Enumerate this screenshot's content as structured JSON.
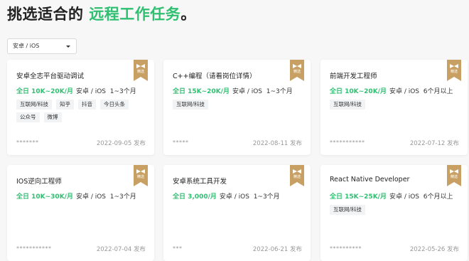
{
  "heading": {
    "prefix": "挑选适合的",
    "highlight": "远程工作任务",
    "suffix": "。"
  },
  "filter": {
    "selected": "安卓 / iOS"
  },
  "ribbon_label": "精选",
  "publish_suffix": "发布",
  "jobs": [
    {
      "title": "安卓全志平台驱动调试",
      "salary": "全日 10K~20K/月",
      "platform": "安卓 / iOS",
      "duration": "1~3个月",
      "tags": [
        "互联网/科技",
        "知乎",
        "抖音",
        "今日头条",
        "公众号",
        "微博"
      ],
      "masked": "*******",
      "date": "2022-09-05"
    },
    {
      "title": "C++编程（请看岗位详情）",
      "salary": "全日 15K~20K/月",
      "platform": "安卓 / iOS",
      "duration": "1~3个月",
      "tags": [
        "互联网/科技"
      ],
      "masked": "*****",
      "date": "2022-08-11"
    },
    {
      "title": "前端开发工程师",
      "salary": "全日 10K~20K/月",
      "platform": "安卓 / iOS",
      "duration": "6个月以上",
      "tags": [
        "互联网/科技"
      ],
      "masked": "***********",
      "date": "2022-07-12"
    },
    {
      "title": "IOS逆向工程师",
      "salary": "全日 10K~30K/月",
      "platform": "安卓 / iOS",
      "duration": "1~3个月",
      "tags": [],
      "masked": "***********",
      "date": "2022-07-04"
    },
    {
      "title": "安卓系统工具开发",
      "salary": "全日 3,000/月",
      "platform": "安卓 / iOS",
      "duration": "1~3个月",
      "tags": [],
      "masked": "***",
      "date": "2022-06-21"
    },
    {
      "title": "React Native Developer",
      "salary": "全日 15K~25K/月",
      "platform": "安卓 / iOS",
      "duration": "6个月以上",
      "tags": [
        "互联网/科技"
      ],
      "masked": "**********",
      "date": "2022-05-26"
    }
  ]
}
